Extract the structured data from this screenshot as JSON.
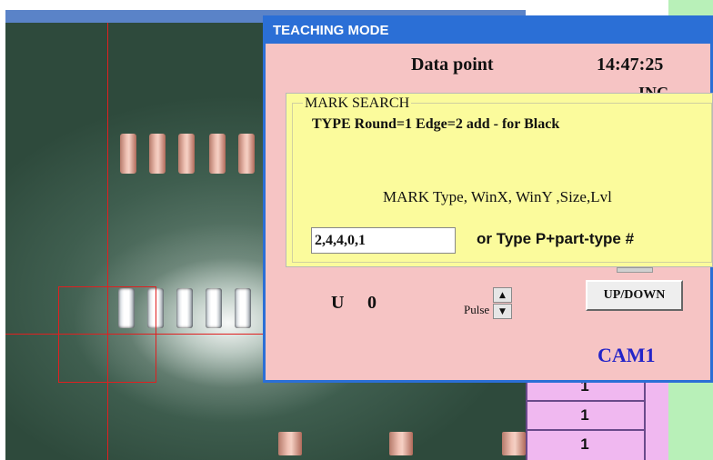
{
  "window": {
    "title": "TEACHING MODE",
    "data_point_label": "Data point",
    "time": "14:47:25",
    "partially_hidden_text": "INC"
  },
  "mark_search": {
    "group_label": "MARK SEARCH",
    "type_help": "TYPE Round=1 Edge=2 add - for Black",
    "columns_label": "MARK Type, WinX, WinY ,Size,Lvl",
    "input_value": "2,4,4,0,1",
    "or_label": "or Type P+part-type #"
  },
  "controls": {
    "u_label": "U",
    "u_value": "0",
    "pulse_label": "Pulse",
    "up_arrow": "▲",
    "down_arrow": "▼",
    "updown_label": "UP/DOWN",
    "camera_label": "CAM1"
  },
  "table": {
    "rows": [
      "1",
      "1",
      "1"
    ]
  }
}
